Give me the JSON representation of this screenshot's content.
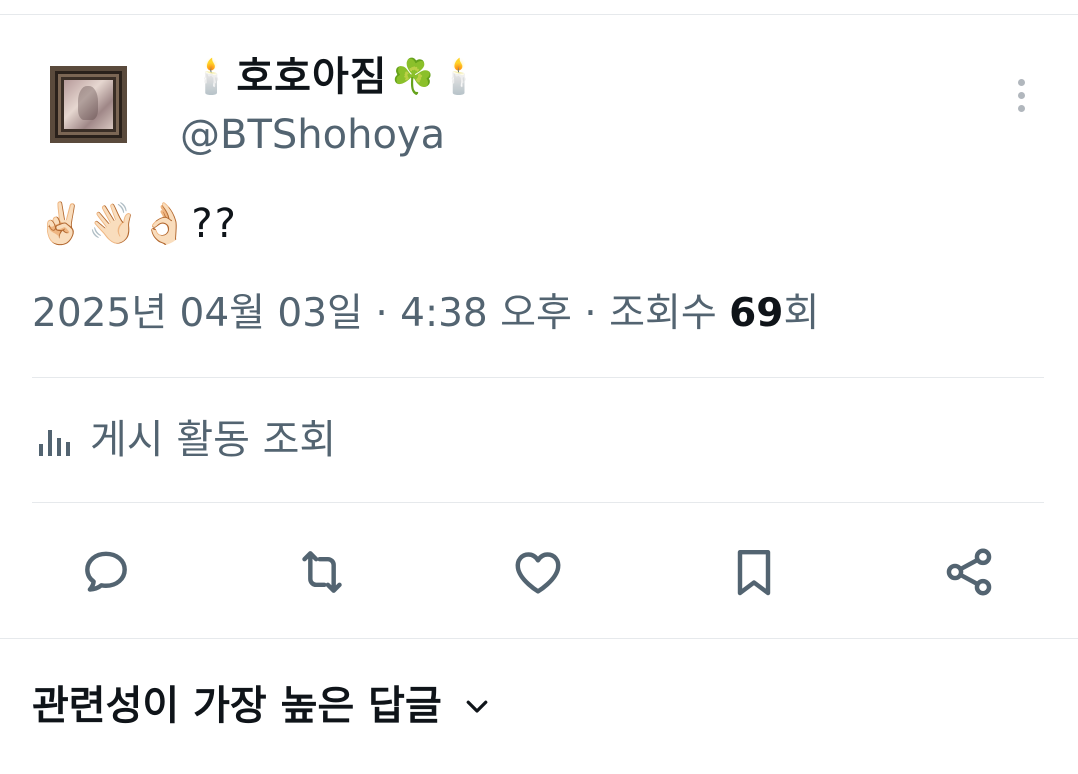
{
  "author": {
    "display_name": "호호아짐",
    "name_emoji_left": "🕯️",
    "name_emoji_clover": "☘️",
    "name_emoji_right": "🕯️",
    "handle": "@BTShohoya"
  },
  "tweet": {
    "text": "✌🏻👋🏻👌🏻??"
  },
  "meta": {
    "date": "2025년 04월 03일",
    "separator": " · ",
    "time": "4:38 오후",
    "views_label": "조회수",
    "views_count": "69",
    "views_suffix": "회"
  },
  "analytics": {
    "label": "게시 활동 조회",
    "icon": "bar-chart-icon"
  },
  "actions": [
    {
      "name": "reply",
      "icon": "speech-bubble-icon"
    },
    {
      "name": "retweet",
      "icon": "repost-arrows-icon"
    },
    {
      "name": "like",
      "icon": "heart-icon"
    },
    {
      "name": "bookmark",
      "icon": "bookmark-icon"
    },
    {
      "name": "share",
      "icon": "share-nodes-icon"
    }
  ],
  "replies_sort": {
    "label": "관련성이 가장 높은 답글",
    "icon": "chevron-down-icon"
  },
  "colors": {
    "text_primary": "#0f1419",
    "text_secondary": "#536471",
    "icon_gray": "#536471",
    "divider": "#e6e9ec"
  }
}
